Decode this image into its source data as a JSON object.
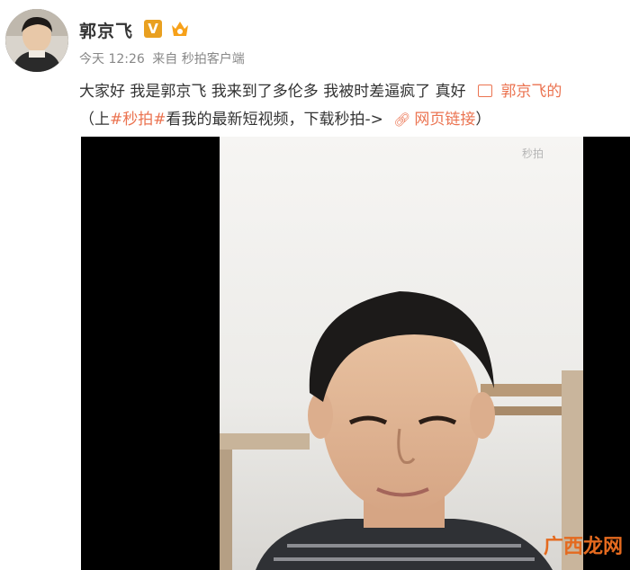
{
  "user": {
    "name": "郭京飞",
    "verified_badge": "V"
  },
  "meta": {
    "time": "今天 12:26",
    "source": "来自 秒拍客户端"
  },
  "post": {
    "text": "大家好 我是郭京飞 我来到了多伦多 我被时差逼疯了 真好",
    "link_text": "郭京飞的",
    "line2_prefix": "（上",
    "hashtag": "#秒拍#",
    "line2_middle": "看我的最新短视频，下载秒拍->",
    "webpage_link": "网页链接",
    "line2_suffix": "）"
  },
  "video": {
    "watermark_top": "秒拍",
    "watermark_bottom": "广西龙网"
  },
  "icons": {
    "verified": "verified-v-icon",
    "member": "member-crown-icon",
    "video_link": "video-link-icon",
    "chain": "chain-link-icon"
  },
  "colors": {
    "link": "#eb7350",
    "verified": "#e9a020",
    "text": "#333333",
    "meta": "#888888"
  }
}
